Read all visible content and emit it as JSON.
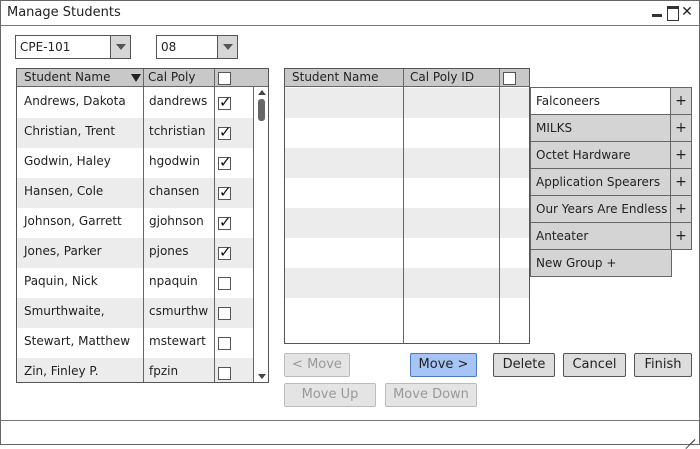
{
  "window": {
    "title": "Manage Students"
  },
  "filters": {
    "course": "CPE-101",
    "section": "08"
  },
  "students_table": {
    "headers": {
      "name": "Student Name",
      "id": "Cal Poly"
    },
    "rows": [
      {
        "name": "Andrews, Dakota",
        "id": "dandrews",
        "checked": true
      },
      {
        "name": "Christian, Trent",
        "id": "tchristian",
        "checked": true
      },
      {
        "name": "Godwin, Haley",
        "id": "hgodwin",
        "checked": true
      },
      {
        "name": "Hansen, Cole",
        "id": "chansen",
        "checked": true
      },
      {
        "name": "Johnson, Garrett",
        "id": "gjohnson",
        "checked": true
      },
      {
        "name": "Jones, Parker",
        "id": "pjones",
        "checked": true
      },
      {
        "name": "Paquin, Nick",
        "id": "npaquin",
        "checked": false
      },
      {
        "name": "Smurthwaite,",
        "id": "csmurthw",
        "checked": false
      },
      {
        "name": "Stewart, Matthew",
        "id": "mstewart",
        "checked": false
      },
      {
        "name": "Zin, Finley P.",
        "id": "fpzin",
        "checked": false
      }
    ]
  },
  "group_table": {
    "headers": {
      "name": "Student Name",
      "id": "Cal Poly ID"
    },
    "row_count": 8
  },
  "groups": {
    "items": [
      {
        "label": "Falconeers",
        "selected": true,
        "plus": "+"
      },
      {
        "label": "MILKS",
        "selected": false,
        "plus": "+"
      },
      {
        "label": "Octet Hardware",
        "selected": false,
        "plus": "+"
      },
      {
        "label": "Application Spearers",
        "selected": false,
        "plus": "+"
      },
      {
        "label": "Our Years Are Endless",
        "selected": false,
        "plus": "+"
      },
      {
        "label": "Anteater",
        "selected": false,
        "plus": "+"
      }
    ],
    "new_group": "New Group +"
  },
  "buttons": {
    "move_back": "< Move",
    "move": "Move >",
    "delete": "Delete",
    "cancel": "Cancel",
    "finish": "Finish",
    "move_up": "Move Up",
    "move_down": "Move Down"
  },
  "colors": {
    "primary_button": "#a6c5f5",
    "header_bg": "#c8c8c8",
    "row_alt": "#ececec"
  }
}
